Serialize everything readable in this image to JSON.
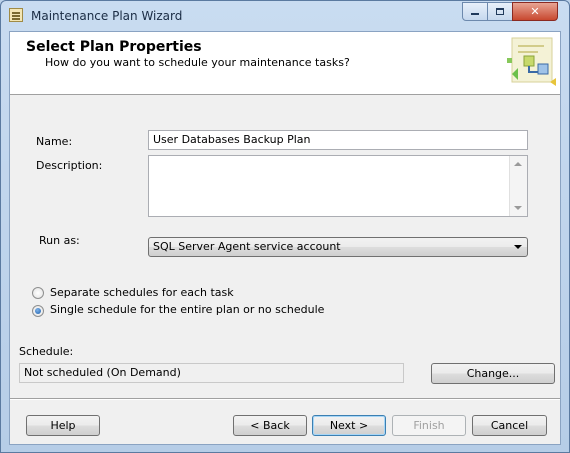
{
  "window": {
    "title": "Maintenance Plan Wizard"
  },
  "header": {
    "title": "Select Plan Properties",
    "subtitle": "How do you want to schedule your maintenance tasks?"
  },
  "form": {
    "name_label": "Name:",
    "name_value": "User Databases Backup Plan",
    "description_label": "Description:",
    "description_value": "",
    "run_as_label": "Run as:",
    "run_as_value": "SQL Server Agent service account"
  },
  "schedule_options": [
    {
      "label": "Separate schedules for each task",
      "checked": false
    },
    {
      "label": "Single schedule for the entire plan or no schedule",
      "checked": true
    }
  ],
  "schedule": {
    "label": "Schedule:",
    "value": "Not scheduled (On Demand)",
    "change_button": "Change..."
  },
  "footer": {
    "help": "Help",
    "back": "< Back",
    "next": "Next >",
    "finish": "Finish",
    "cancel": "Cancel"
  },
  "colors": {
    "frame": "#b6cde7",
    "close_button": "#c8482f",
    "dialog_bg": "#f0f0f0"
  }
}
